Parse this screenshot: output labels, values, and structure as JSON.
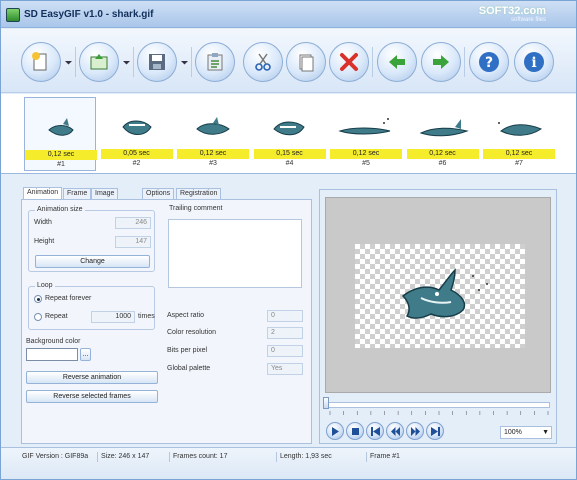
{
  "window": {
    "title": "SD EasyGIF v1.0 - shark.gif",
    "watermark": "SOFT32.com",
    "watermark_sub": "software files"
  },
  "toolbar": {
    "buttons": [
      "new-icon",
      "open-icon",
      "save-icon",
      "paste-frames-icon",
      "cut-icon",
      "copy-icon",
      "delete-icon",
      "back-arrow-icon",
      "forward-arrow-icon",
      "help-icon",
      "info-icon"
    ]
  },
  "frames": [
    {
      "delay": "0,12 sec",
      "num": "#1"
    },
    {
      "delay": "0,05 sec",
      "num": "#2"
    },
    {
      "delay": "0,12 sec",
      "num": "#3"
    },
    {
      "delay": "0,15 sec",
      "num": "#4"
    },
    {
      "delay": "0,12 sec",
      "num": "#5"
    },
    {
      "delay": "0,12 sec",
      "num": "#6"
    },
    {
      "delay": "0,12 sec",
      "num": "#7"
    }
  ],
  "tabs": [
    "Animation",
    "Frame",
    "Image Editor",
    "Options",
    "Registration"
  ],
  "animation_size": {
    "legend": "Animation size",
    "width_label": "Width",
    "width_value": "246",
    "height_label": "Height",
    "height_value": "147",
    "change_button": "Change"
  },
  "loop": {
    "legend": "Loop",
    "repeat_forever": "Repeat forever",
    "repeat": "Repeat",
    "repeat_value": "1000",
    "times": "times"
  },
  "background": {
    "label": "Background color",
    "browse": "..."
  },
  "actions": {
    "reverse_animation": "Reverse animation",
    "reverse_selected": "Reverse selected frames"
  },
  "trailing_comment": {
    "label": "Trailing comment"
  },
  "props": [
    {
      "label": "Aspect ratio",
      "value": "0"
    },
    {
      "label": "Color resolution",
      "value": "2"
    },
    {
      "label": "Bits per pixel",
      "value": "0"
    },
    {
      "label": "Global palette",
      "value": "Yes"
    }
  ],
  "preview": {
    "zoom": "100%"
  },
  "status": {
    "version": "GIF Version : GIF89a",
    "size": "Size: 246 x 147",
    "frames": "Frames count: 17",
    "length": "Length: 1,93 sec",
    "current_frame": "Frame #1"
  }
}
